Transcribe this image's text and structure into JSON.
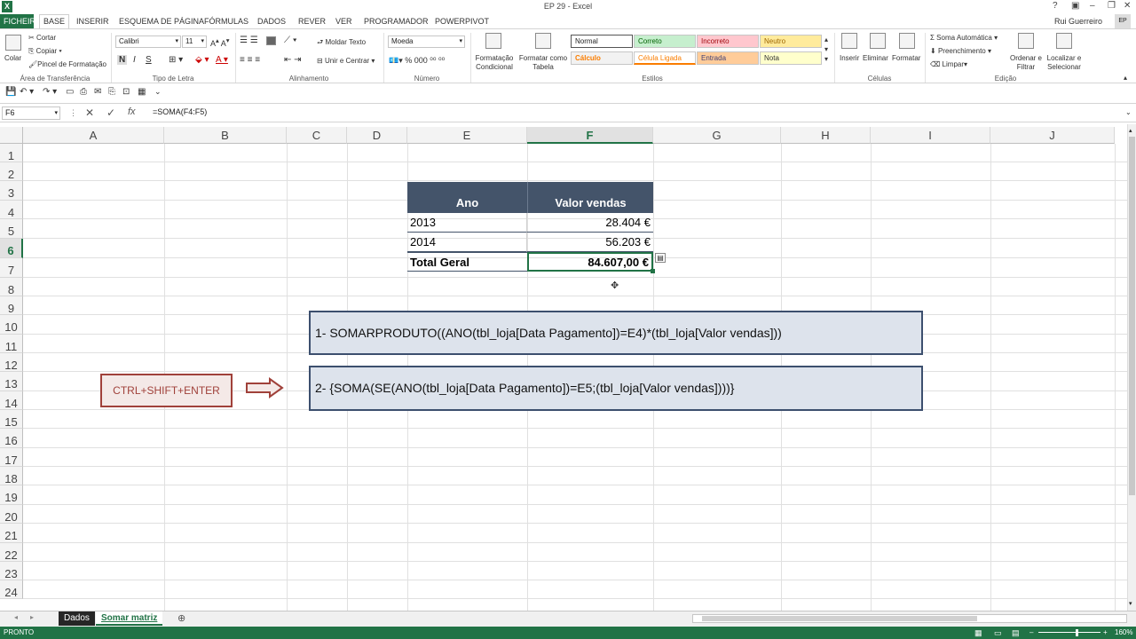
{
  "window": {
    "title": "EP 29 - Excel",
    "user": "Rui Guerreiro",
    "avatar": "EP"
  },
  "tabs": [
    "FICHEIRO",
    "BASE",
    "INSERIR",
    "ESQUEMA DE PÁGINA",
    "FÓRMULAS",
    "DADOS",
    "REVER",
    "VER",
    "PROGRAMADOR",
    "POWERPIVOT"
  ],
  "ribbon": {
    "clipboard": {
      "paste": "Colar",
      "cut": "Cortar",
      "copy": "Copiar",
      "format_painter": "Pincel de Formatação",
      "label": "Área de Transferência"
    },
    "font": {
      "name": "Calibri",
      "size": "11",
      "label": "Tipo de Letra"
    },
    "alignment": {
      "wrap": "Moldar Texto",
      "merge": "Unir e Centrar",
      "label": "Alinhamento"
    },
    "number": {
      "format": "Moeda",
      "label": "Número"
    },
    "styles": {
      "cond_format": "Formatação Condicional",
      "format_table": "Formatar como Tabela",
      "cells": [
        "Normal",
        "Correto",
        "Incorreto",
        "Neutro",
        "Cálculo",
        "Célula Ligada",
        "Entrada",
        "Nota"
      ],
      "label": "Estilos"
    },
    "cells": {
      "insert": "Inserir",
      "delete": "Eliminar",
      "format": "Formatar",
      "label": "Células"
    },
    "editing": {
      "autosum": "Soma Automática",
      "fill": "Preenchimento",
      "clear": "Limpar",
      "sort": "Ordenar e Filtrar",
      "find": "Localizar e Selecionar",
      "label": "Edição"
    }
  },
  "formula_bar": {
    "name_box": "F6",
    "formula": "=SOMA(F4:F5)",
    "fx": "fx"
  },
  "columns": [
    "A",
    "B",
    "C",
    "D",
    "E",
    "F",
    "G",
    "H",
    "I",
    "J"
  ],
  "rows": [
    "1",
    "2",
    "3",
    "4",
    "5",
    "6",
    "7",
    "8",
    "9",
    "10",
    "11",
    "12",
    "13",
    "14",
    "15",
    "16",
    "17",
    "18",
    "19",
    "20",
    "21",
    "22",
    "23",
    "24"
  ],
  "table": {
    "headers": [
      "Ano",
      "Valor  vendas"
    ],
    "rows": [
      [
        "2013",
        "28.404 €"
      ],
      [
        "2014",
        "56.203 €"
      ],
      [
        "Total Geral",
        "84.607,00 €"
      ]
    ]
  },
  "formula1": "1- SOMARPRODUTO((ANO(tbl_loja[Data Pagamento])=E4)*(tbl_loja[Valor  vendas]))",
  "formula2": "2- {SOMA(SE(ANO(tbl_loja[Data Pagamento])=E5;(tbl_loja[Valor  vendas])))}",
  "shortcut": "CTRL+SHIFT+ENTER",
  "sheets": [
    "Dados",
    "Somar matriz"
  ],
  "status": {
    "mode": "PRONTO",
    "zoom": "160%"
  }
}
